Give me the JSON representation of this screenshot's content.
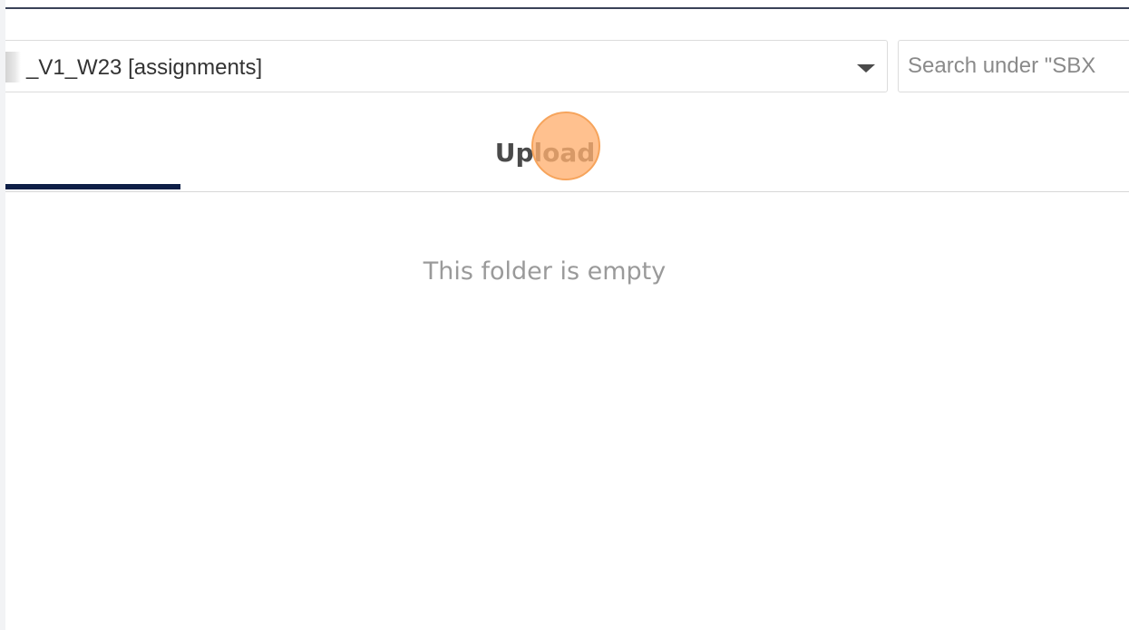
{
  "folder_select": {
    "value": "_V1_W23 [assignments]",
    "caret_icon": "caret-down-icon"
  },
  "search": {
    "placeholder": "Search under \"SBX"
  },
  "tabs": {
    "upload_label": "Upload"
  },
  "content": {
    "empty_message": "This folder is empty"
  },
  "colors": {
    "active_tab_indicator": "#0e1f47",
    "click_marker": "#f6a45c"
  }
}
